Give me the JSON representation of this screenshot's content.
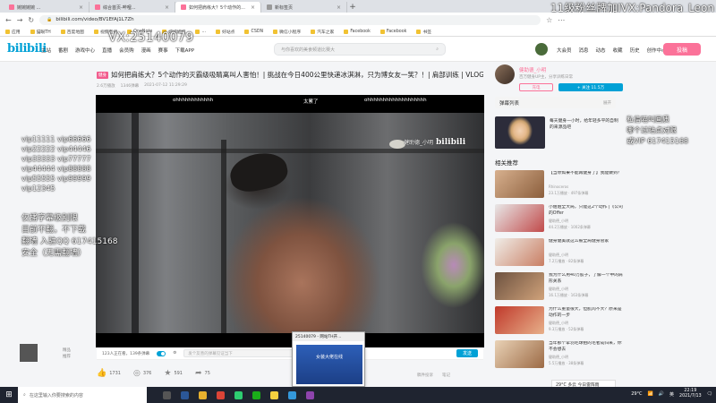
{
  "browser": {
    "tabs": [
      {
        "label": "婉婉婉婉 ..."
      },
      {
        "label": "综合首页-哔哩..."
      },
      {
        "label": "如何把肩练大？5个动作的...",
        "active": true
      },
      {
        "label": "新标签页"
      }
    ],
    "new_tab": "+",
    "url": "bilibili.com/video/BV1EfAj1L7Zh",
    "bookmarks": [
      "应用",
      "猫眼TH",
      "百度地图",
      "视频直播",
      "OneNote",
      "婉婉婉婉",
      "...",
      "好站点",
      "CSDN",
      "微信小程序",
      "汽车之家",
      "Facebook",
      "Facebook",
      "书签"
    ],
    "back_icon": "arrow-left-icon",
    "win_controls": [
      "—",
      "□",
      "✕"
    ]
  },
  "overlays": {
    "top_right": "11级粉丝牌加IVX:Pandora_Leon",
    "vx": "VX:25140079",
    "left_lines": [
      "vip11111 vip66666",
      "vip22222 vip44446",
      "vip33333 vip77777",
      "vip44444 vip88888",
      "vip55555 vip99999",
      "vip12345"
    ],
    "left_notes": [
      "仅播字幕级别限",
      "目前不翻，不下载",
      "翻墙 入驻QQ 617415168",
      "安全（无需翻墙）"
    ],
    "right_lines": [
      "私信喵叫画质",
      "哪个过站点对限",
      "或VIP 617415168"
    ]
  },
  "bilibili": {
    "logo": "bilibili",
    "nav": [
      "主站",
      "番剧",
      "游戏中心",
      "直播",
      "会员购",
      "漫画",
      "赛事",
      "下载APP"
    ],
    "search_placeholder": "与你喜欢的美食频道比赛大",
    "right_nav": [
      "大会员",
      "消息",
      "动态",
      "收藏",
      "历史",
      "创作中心"
    ],
    "upload_label": "投稿"
  },
  "video": {
    "tag": "健身",
    "title": "如何把肩练大？5个动作的灭霸级吸睛离叫人害怕！| 挑战在今日400公里快递冰淇淋，只为博女友一笑？！| 肩部训练 | VLOG",
    "meta": [
      "2.6万播放",
      "1346弹幕",
      "2021-07-12 11:29:29"
    ],
    "danmu": [
      {
        "text": "ohhhhhhhhhhhh"
      },
      {
        "text": "太累了"
      },
      {
        "text": "ohhhhhhhhhhhhhhhhhhh"
      }
    ],
    "watermark": "健助德_小明",
    "watermark_logo": "bilibili",
    "viewers": "123人正在看，139条弹幕",
    "danmu_placeholder": "发个友善的弹幕见证当下",
    "send_label": "发送",
    "danmu_etiquette": "弹幕礼仪",
    "actions": [
      {
        "icon": "thumbs-up-icon",
        "value": "1731"
      },
      {
        "icon": "coin-icon",
        "value": "376"
      },
      {
        "icon": "star-icon",
        "value": "591"
      },
      {
        "icon": "share-icon",
        "value": "75"
      }
    ],
    "share_extra": [
      "稿件投诉",
      "笔记"
    ],
    "anchor_label": [
      "精品",
      "推荐"
    ]
  },
  "uploader": {
    "name": "健助德_小明",
    "desc": "百万健身UP主，分享训练日常",
    "charge": "充电",
    "follow": "+ 关注 11.5万"
  },
  "sidebar": {
    "danmu_list": "弹幕列表",
    "expand": "展开",
    "featured": "每天健身一小时，给年轻多平的自制的来源品吧",
    "related_head": "相关推荐",
    "related": [
      {
        "title": "【当你如果不能再健身了】我能做到？",
        "up": "Rhinoceros",
        "stats": "23.1万播放 · 497条弹幕"
      },
      {
        "title": "小姐姐全大局，只能这2个动作 |《公司的Offer",
        "up": "健助德_小明",
        "stats": "44.2万播放 · 1002条弹幕"
      },
      {
        "title": "健身健美就这么被全局健身管家",
        "up": "健助德_小明",
        "stats": "7.2万播放 · 82条弹幕"
      },
      {
        "title": "我为什么用40万胶子，了解一个中的肩形关系",
        "up": "健助德_小明",
        "stats": "16.1万播放 · 163条弹幕"
      },
      {
        "title": "为什么重量很大，但肌肉不大？原来是动作的一步",
        "up": "健助德_小明",
        "stats": "9.3万播放 · 52条弹幕"
      },
      {
        "title": "当年那个拿羽毛球拍的毛者成归来，你不会想去",
        "up": "健助德_小明",
        "stats": "5.5万播放 · 38条弹幕"
      }
    ]
  },
  "popup": {
    "title": "25140079 - 网站TH开...",
    "body": "女装大佬在线"
  },
  "weather": "29°C 多云 今日雷阵雨",
  "taskbar": {
    "search_placeholder": "在这里输入你要搜索的内容",
    "time": "22:19",
    "date": "2021/7/13",
    "temp": "29°C",
    "lang": "英"
  },
  "colors": {
    "accent": "#00a1d6",
    "pink": "#fb7299"
  }
}
